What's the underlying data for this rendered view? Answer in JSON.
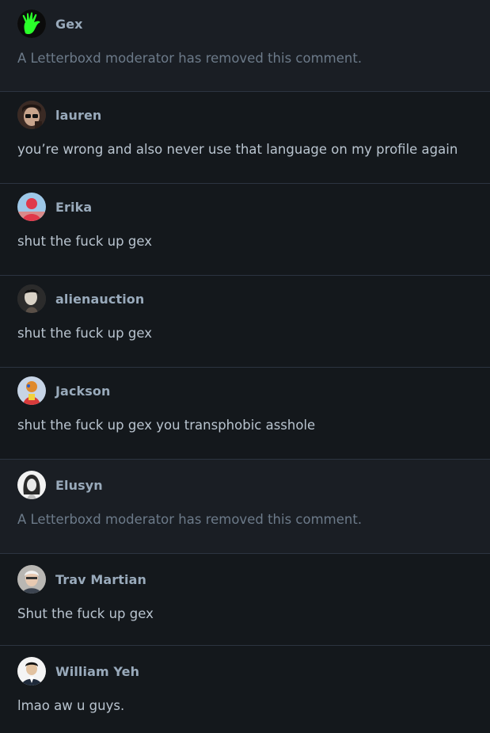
{
  "comments": [
    {
      "username": "Gex",
      "text": "A Letterboxd moderator has removed this comment.",
      "removed": true,
      "avatar": "green-hand-icon",
      "colors": [
        "#0b0b0b",
        "#2aff2a"
      ]
    },
    {
      "username": "lauren",
      "text": "you’re wrong and also never use that language on my profile again",
      "removed": false,
      "avatar": "portrait-with-glasses",
      "colors": [
        "#3a2a24",
        "#c8a48c"
      ]
    },
    {
      "username": "Erika",
      "text": "shut the fuck up gex",
      "removed": false,
      "avatar": "red-figure-portrait",
      "colors": [
        "#9ec8e8",
        "#e0394a"
      ]
    },
    {
      "username": "alienauction",
      "text": "shut the fuck up gex",
      "removed": false,
      "avatar": "dark-portrait",
      "colors": [
        "#2b2b2b",
        "#d9d2c6"
      ]
    },
    {
      "username": "Jackson",
      "text": "shut the fuck up gex you transphobic asshole",
      "removed": false,
      "avatar": "colorful-character",
      "colors": [
        "#c7d4e6",
        "#e08a2c"
      ]
    },
    {
      "username": "Elusyn",
      "text": "A Letterboxd moderator has removed this comment.",
      "removed": true,
      "avatar": "sketch-portrait",
      "colors": [
        "#f2f2f2",
        "#2a2a2a"
      ]
    },
    {
      "username": "Trav Martian",
      "text": "Shut the fuck up gex",
      "removed": false,
      "avatar": "gray-hair-portrait",
      "colors": [
        "#b9b7b3",
        "#e7c9b1"
      ]
    },
    {
      "username": "William Yeh",
      "text": "lmao aw u guys.",
      "removed": false,
      "avatar": "suit-portrait",
      "colors": [
        "#f4f4f4",
        "#1f2a3a"
      ]
    }
  ]
}
